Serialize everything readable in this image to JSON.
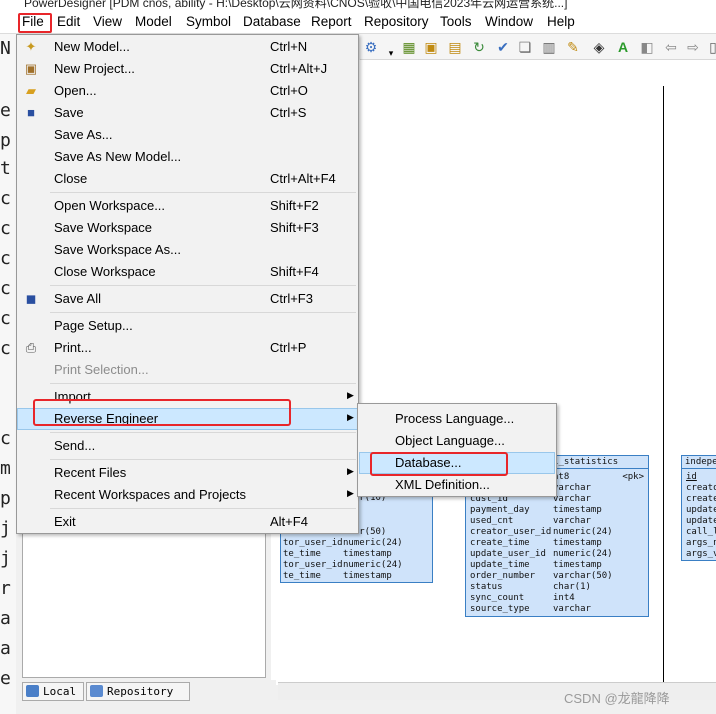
{
  "window": {
    "title": "PowerDesigner [PDM cnos, ability - H:\\Desktop\\云网资料\\CNOS\\验收\\中国电信2023年云网运营系统...]"
  },
  "menubar": [
    "File",
    "Edit",
    "View",
    "Model",
    "Symbol",
    "Database",
    "Report",
    "Repository",
    "Tools",
    "Window",
    "Help"
  ],
  "file_menu": [
    {
      "label": "New Model...",
      "shortcut": "Ctrl+N",
      "icon": "new-model-icon"
    },
    {
      "label": "New Project...",
      "shortcut": "Ctrl+Alt+J",
      "icon": "new-project-icon"
    },
    {
      "label": "Open...",
      "shortcut": "Ctrl+O",
      "icon": "open-folder-icon"
    },
    {
      "label": "Save",
      "shortcut": "Ctrl+S",
      "icon": "save-icon"
    },
    {
      "label": "Save As...",
      "shortcut": ""
    },
    {
      "label": "Save As New Model...",
      "shortcut": ""
    },
    {
      "label": "Close",
      "shortcut": "Ctrl+Alt+F4"
    },
    {
      "label": "Open Workspace...",
      "shortcut": "Shift+F2"
    },
    {
      "label": "Save Workspace",
      "shortcut": "Shift+F3"
    },
    {
      "label": "Save Workspace As...",
      "shortcut": ""
    },
    {
      "label": "Close Workspace",
      "shortcut": "Shift+F4"
    },
    {
      "label": "Save All",
      "shortcut": "Ctrl+F3",
      "icon": "save-all-icon"
    },
    {
      "label": "Page Setup...",
      "shortcut": ""
    },
    {
      "label": "Print...",
      "shortcut": "Ctrl+P",
      "icon": "print-icon"
    },
    {
      "label": "Print Selection...",
      "shortcut": "",
      "disabled": true
    },
    {
      "label": "Import",
      "shortcut": "",
      "submenu": true
    },
    {
      "label": "Reverse Engineer",
      "shortcut": "",
      "submenu": true,
      "highlighted": true
    },
    {
      "label": "Send...",
      "shortcut": ""
    },
    {
      "label": "Recent Files",
      "shortcut": "",
      "submenu": true
    },
    {
      "label": "Recent Workspaces and Projects",
      "shortcut": "",
      "submenu": true
    },
    {
      "label": "Exit",
      "shortcut": "Alt+F4"
    }
  ],
  "reverse_engineer_submenu": [
    "Process Language...",
    "Object Language...",
    "Database...",
    "XML Definition..."
  ],
  "left_chars": [
    "N",
    "e",
    "p",
    "t",
    "c",
    "c",
    "c",
    "c",
    "c",
    "c",
    "c",
    "c",
    "m",
    "p",
    "j",
    "j",
    "r",
    "a",
    "a",
    "e"
  ],
  "browser_tabs": [
    "Local",
    "Repository"
  ],
  "table1": {
    "title": "y_call_statistics",
    "pk": "<pk>",
    "rows": [
      [
        "",
        "nt8"
      ],
      [
        "",
        "varchar"
      ],
      [
        "cust_id",
        "varchar"
      ],
      [
        "payment_day",
        "timestamp"
      ],
      [
        "used_cnt",
        "varchar"
      ],
      [
        "creator_user_id",
        "numeric(24)"
      ],
      [
        "create_time",
        "timestamp"
      ],
      [
        "update_user_id",
        "numeric(24)"
      ],
      [
        "update_time",
        "timestamp"
      ],
      [
        "order_number",
        "varchar(50)"
      ],
      [
        "status",
        "char(1)"
      ],
      [
        "sync_count",
        "int4"
      ],
      [
        "source_type",
        "varchar"
      ]
    ]
  },
  "table2": {
    "rows": [
      [
        "",
        "char(10)"
      ],
      [
        "",
        ""
      ],
      [
        "",
        ""
      ],
      [
        "",
        "char(50)"
      ],
      [
        "tor_user_id",
        "numeric(24)"
      ],
      [
        "te_time",
        "timestamp"
      ],
      [
        "tor_user_id",
        "numeric(24)"
      ],
      [
        "te_time",
        "timestamp"
      ]
    ]
  },
  "table3": {
    "title": "indepe",
    "rows": [
      "id",
      "creato",
      "create",
      "update",
      "update",
      "call_l",
      "args_n",
      "args_v"
    ]
  },
  "watermark": "CSDN @龙龍降降"
}
